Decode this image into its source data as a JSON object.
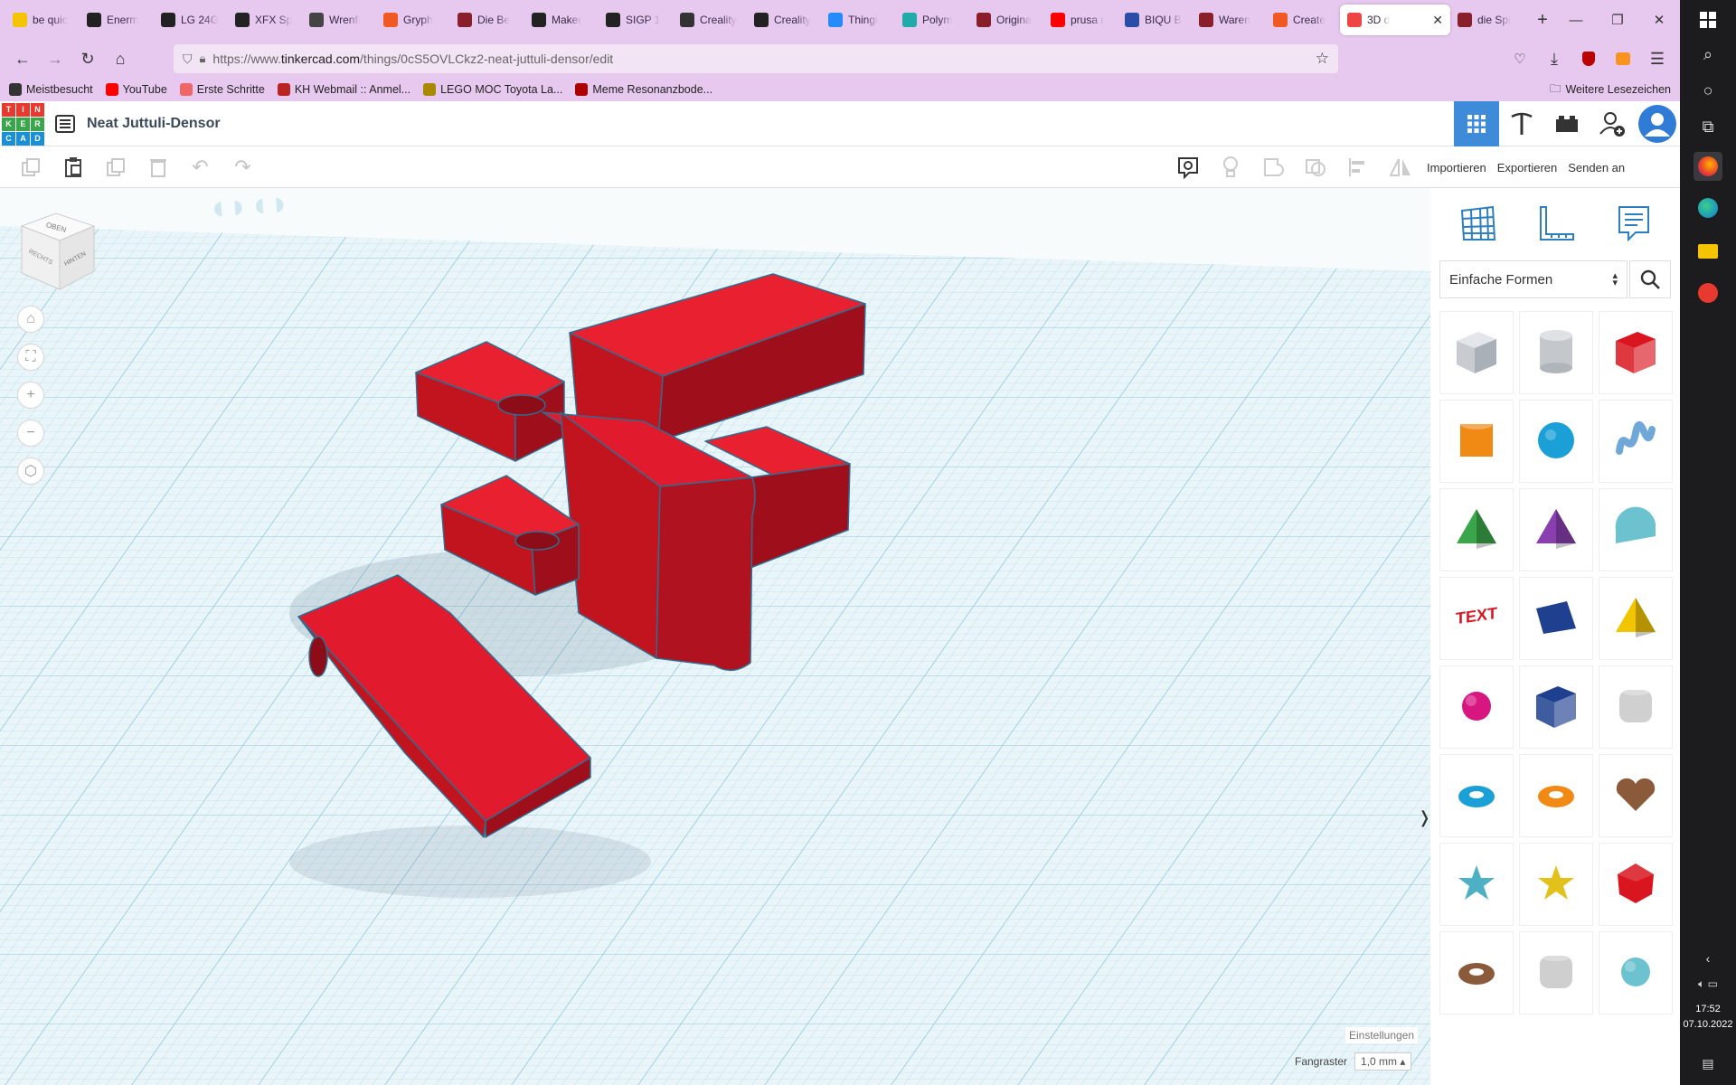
{
  "browser": {
    "tabs": [
      {
        "label": "be quic",
        "icon": "pen-icon",
        "color": "#f5c400"
      },
      {
        "label": "Enerm",
        "icon": "amazon-icon",
        "color": "#222"
      },
      {
        "label": "LG 24G",
        "icon": "gear-icon",
        "color": "#222"
      },
      {
        "label": "XFX Sp",
        "icon": "amazon-icon",
        "color": "#222"
      },
      {
        "label": "Wrenfi",
        "icon": "wrench-icon",
        "color": "#444"
      },
      {
        "label": "Gryph",
        "icon": "create-icon",
        "color": "#f05a22"
      },
      {
        "label": "Die Be",
        "icon": "printables-icon",
        "color": "#8a1f2c"
      },
      {
        "label": "Maker",
        "icon": "amazon-icon",
        "color": "#222"
      },
      {
        "label": "SIGP 1",
        "icon": "amazon-icon",
        "color": "#222"
      },
      {
        "label": "Creality",
        "icon": "creality-icon",
        "color": "#333"
      },
      {
        "label": "Creality",
        "icon": "amazon-icon",
        "color": "#222"
      },
      {
        "label": "Thingi",
        "icon": "thingiverse-icon",
        "color": "#248bfb"
      },
      {
        "label": "Polym",
        "icon": "polymaker-icon",
        "color": "#2aa"
      },
      {
        "label": "Origina",
        "icon": "printables-icon",
        "color": "#8a1f2c"
      },
      {
        "label": "prusa r",
        "icon": "youtube-icon",
        "color": "#f00"
      },
      {
        "label": "BIQU B",
        "icon": "biqu-icon",
        "color": "#2a4da8"
      },
      {
        "label": "Waren",
        "icon": "printables-icon",
        "color": "#8a1f2c"
      },
      {
        "label": "Create",
        "icon": "create-icon",
        "color": "#f05a22"
      },
      {
        "label": "3D d",
        "icon": "tinkercad-icon",
        "color": "#e44",
        "active": true
      },
      {
        "label": "die Spi",
        "icon": "printables-icon",
        "color": "#8a1f2c"
      }
    ],
    "url_prefix": "https://www.",
    "url_domain": "tinkercad.com",
    "url_path": "/things/0cS5OVLCkz2-neat-juttuli-densor/edit",
    "bookmarks": [
      {
        "label": "Meistbesucht",
        "icon": "gear-icon",
        "color": "#333"
      },
      {
        "label": "YouTube",
        "icon": "youtube-icon",
        "color": "#f00"
      },
      {
        "label": "Erste Schritte",
        "icon": "firefox-icon",
        "color": "#e66"
      },
      {
        "label": "KH Webmail :: Anmel...",
        "icon": "mail-icon",
        "color": "#b22"
      },
      {
        "label": "LEGO MOC Toyota La...",
        "icon": "lego-icon",
        "color": "#a80"
      },
      {
        "label": "Meme Resonanzbode...",
        "icon": "circle-icon",
        "color": "#a00"
      }
    ],
    "more_bookmarks": "Weitere Lesezeichen"
  },
  "tinkercad": {
    "logo_letters": [
      "T",
      "I",
      "N",
      "K",
      "E",
      "R",
      "C",
      "A",
      "D"
    ],
    "logo_colors": [
      "#e8392f",
      "#e8392f",
      "#e8392f",
      "#3aa64a",
      "#3aa64a",
      "#3aa64a",
      "#1a8fd6",
      "#1a8fd6",
      "#1a8fd6"
    ],
    "design_title": "Neat Juttuli-Densor",
    "toolbar": {
      "import": "Importieren",
      "export": "Exportieren",
      "send": "Senden an"
    },
    "viewcube": {
      "top": "OBEN",
      "left": "RECHTS",
      "right": "HINTEN"
    },
    "settings_label": "Einstellungen",
    "snap_label": "Fangraster",
    "snap_value": "1,0 mm"
  },
  "shapes_panel": {
    "category": "Einfache Formen",
    "shapes": [
      {
        "name": "box-hole-icon",
        "color": "#bfc5cc"
      },
      {
        "name": "cylinder-hole-icon",
        "color": "#c4c8cd"
      },
      {
        "name": "box-icon",
        "color": "#d9161f"
      },
      {
        "name": "cylinder-icon",
        "color": "#f08a14"
      },
      {
        "name": "sphere-icon",
        "color": "#1a9fd6"
      },
      {
        "name": "scribble-icon",
        "color": "#6fa8d8"
      },
      {
        "name": "roof-icon",
        "color": "#3aa64a"
      },
      {
        "name": "cone-icon",
        "color": "#8a3fb0"
      },
      {
        "name": "round-roof-icon",
        "color": "#6cc2cf"
      },
      {
        "name": "text-icon",
        "color": "#d9161f"
      },
      {
        "name": "wedge-icon",
        "color": "#1f3f8f"
      },
      {
        "name": "pyramid-icon",
        "color": "#f2c500"
      },
      {
        "name": "half-sphere-icon",
        "color": "#d81680"
      },
      {
        "name": "polygon-icon",
        "color": "#1f3f8f"
      },
      {
        "name": "paraboloid-icon",
        "color": "#d0d0d0"
      },
      {
        "name": "torus-icon",
        "color": "#1a9fd6"
      },
      {
        "name": "tube-icon",
        "color": "#f08a14"
      },
      {
        "name": "heart-icon",
        "color": "#8a5a3a"
      },
      {
        "name": "star-icon",
        "color": "#4eb0c4"
      },
      {
        "name": "star-gold-icon",
        "color": "#e2c21a"
      },
      {
        "name": "icosahedron-icon",
        "color": "#d9161f"
      },
      {
        "name": "ring-icon",
        "color": "#8a5a3a"
      },
      {
        "name": "round-box-icon",
        "color": "#cfcfcf"
      },
      {
        "name": "gem-icon",
        "color": "#6cc2cf"
      }
    ]
  },
  "taskbar": {
    "time": "17:52",
    "date": "07.10.2022"
  },
  "colors": {
    "browser_chrome": "#e7c8ef",
    "model_red": "#e11b2d",
    "accent_blue": "#3d8bd9"
  }
}
